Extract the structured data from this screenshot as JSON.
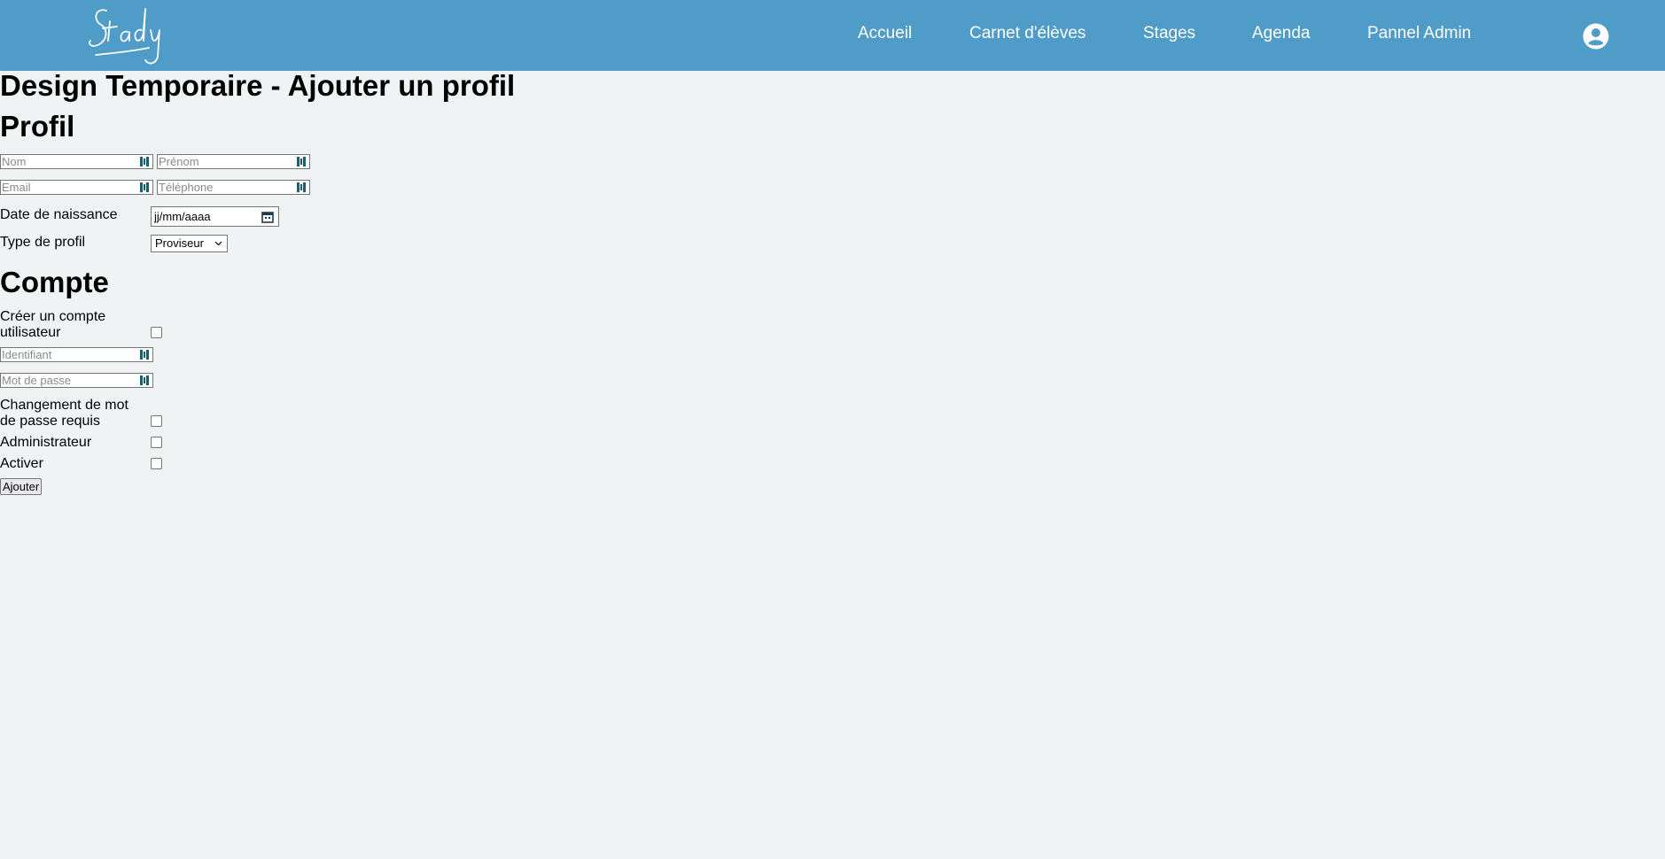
{
  "header": {
    "logo_text": "Stady",
    "nav": [
      {
        "label": "Accueil"
      },
      {
        "label": "Carnet d'élèves"
      },
      {
        "label": "Stages"
      },
      {
        "label": "Agenda"
      },
      {
        "label": "Pannel Admin"
      }
    ],
    "avatar_icon": "user-circle-icon",
    "bar_color": "#4f9cc8"
  },
  "page": {
    "title": "Design Temporaire - Ajouter un profil"
  },
  "profil": {
    "heading": "Profil",
    "nom_placeholder": "Nom",
    "prenom_placeholder": "Prénom",
    "email_placeholder": "Email",
    "telephone_placeholder": "Téléphone",
    "birthdate_label": "Date de naissance",
    "birthdate_placeholder": "jj/mm/aaaa",
    "type_label": "Type de profil",
    "type_selected": "Proviseur"
  },
  "compte": {
    "heading": "Compte",
    "create_account_label_line1": "Créer un compte",
    "create_account_label_line2": "utilisateur",
    "identifiant_placeholder": "Identifiant",
    "password_placeholder": "Mot de passe",
    "change_password_label_line1": "Changement de mot",
    "change_password_label_line2": "de passe requis",
    "admin_label": "Administrateur",
    "activate_label": "Activer",
    "submit_label": "Ajouter"
  }
}
